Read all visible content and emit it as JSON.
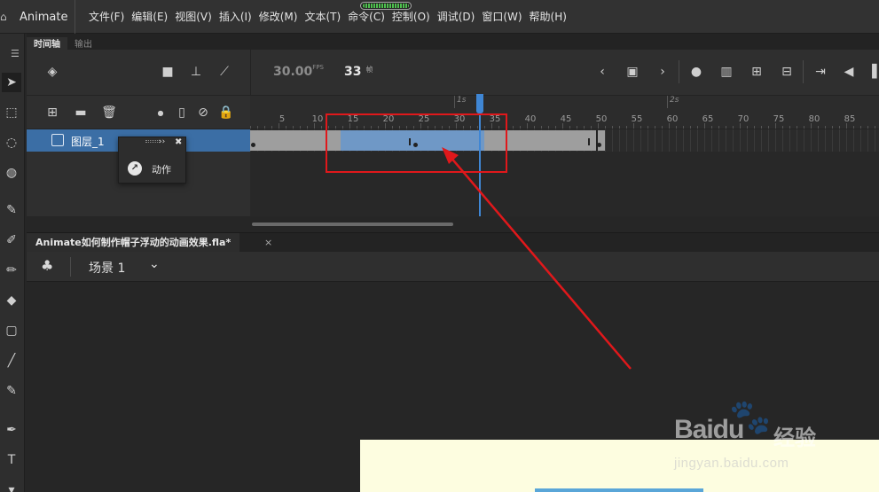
{
  "app": {
    "name": "Animate"
  },
  "menu": {
    "items": [
      {
        "label": "文件(F)"
      },
      {
        "label": "编辑(E)"
      },
      {
        "label": "视图(V)"
      },
      {
        "label": "插入(I)"
      },
      {
        "label": "修改(M)"
      },
      {
        "label": "文本(T)"
      },
      {
        "label": "命令(C)"
      },
      {
        "label": "控制(O)"
      },
      {
        "label": "调试(D)"
      },
      {
        "label": "窗口(W)"
      },
      {
        "label": "帮助(H)"
      }
    ]
  },
  "panel_tabs": [
    {
      "label": "时间轴",
      "active": true
    },
    {
      "label": "输出",
      "active": false
    }
  ],
  "timeline": {
    "fps_value": "30.00",
    "fps_unit": "FPS",
    "current_frame": "33",
    "frame_unit": "帧",
    "ruler_labels": [
      "5",
      "10",
      "15",
      "20",
      "25",
      "30",
      "35",
      "40",
      "45",
      "50",
      "55",
      "60",
      "65",
      "70",
      "75",
      "80",
      "85"
    ],
    "second_marks": [
      "1s",
      "2s"
    ],
    "layer": {
      "name": "图层_1"
    }
  },
  "popup": {
    "action_label": "动作"
  },
  "document": {
    "tab_title": "Animate如何制作帽子浮动的动画效果.fla*",
    "scene_label": "场景 1"
  },
  "watermark": {
    "logo": "Baidu",
    "brand_cn": "经验",
    "url": "jingyan.baidu.com"
  },
  "colors": {
    "annotation": "#e0181b",
    "layer_selected": "#3b6ea5",
    "tween_span": "#6f98c6",
    "playhead": "#3f86d4",
    "stage": "#fdfde0"
  }
}
